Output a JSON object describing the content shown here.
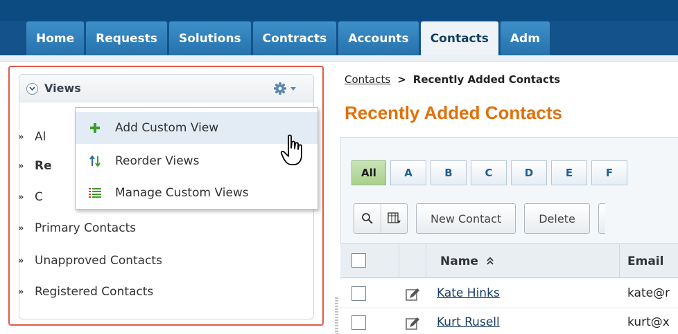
{
  "nav": {
    "tabs": [
      {
        "label": "Home"
      },
      {
        "label": "Requests"
      },
      {
        "label": "Solutions"
      },
      {
        "label": "Contracts"
      },
      {
        "label": "Accounts"
      },
      {
        "label": "Contacts",
        "active": true
      },
      {
        "label": "Adm"
      }
    ]
  },
  "views_panel": {
    "title": "Views",
    "items": [
      {
        "label": "Al"
      },
      {
        "label": "Re",
        "bold": true
      },
      {
        "label": "C"
      },
      {
        "label": "Primary Contacts"
      },
      {
        "label": "Unapproved Contacts"
      },
      {
        "label": "Registered Contacts"
      }
    ]
  },
  "views_menu": {
    "items": [
      {
        "label": "Add Custom View",
        "icon": "plus-icon",
        "highlighted": true
      },
      {
        "label": "Reorder Views",
        "icon": "reorder-arrows-icon"
      },
      {
        "label": "Manage Custom Views",
        "icon": "list-icon"
      }
    ]
  },
  "breadcrumb": {
    "link": "Contacts",
    "separator": ">",
    "current": "Recently Added Contacts"
  },
  "page": {
    "title": "Recently Added Contacts"
  },
  "alphabet_filter": [
    "All",
    "A",
    "B",
    "C",
    "D",
    "E",
    "F"
  ],
  "toolbar": {
    "new_label": "New Contact",
    "delete_label": "Delete"
  },
  "table": {
    "columns": {
      "name": "Name",
      "email": "Email"
    },
    "rows": [
      {
        "name": "Kate Hinks",
        "email": "kate@r"
      },
      {
        "name": "Kurt Rusell",
        "email": "kurt@x"
      }
    ]
  },
  "colors": {
    "nav_bg": "#13528a",
    "tab_bg": "#2d81bd",
    "title_orange": "#e2700a",
    "highlight_border": "#e05a4a"
  }
}
